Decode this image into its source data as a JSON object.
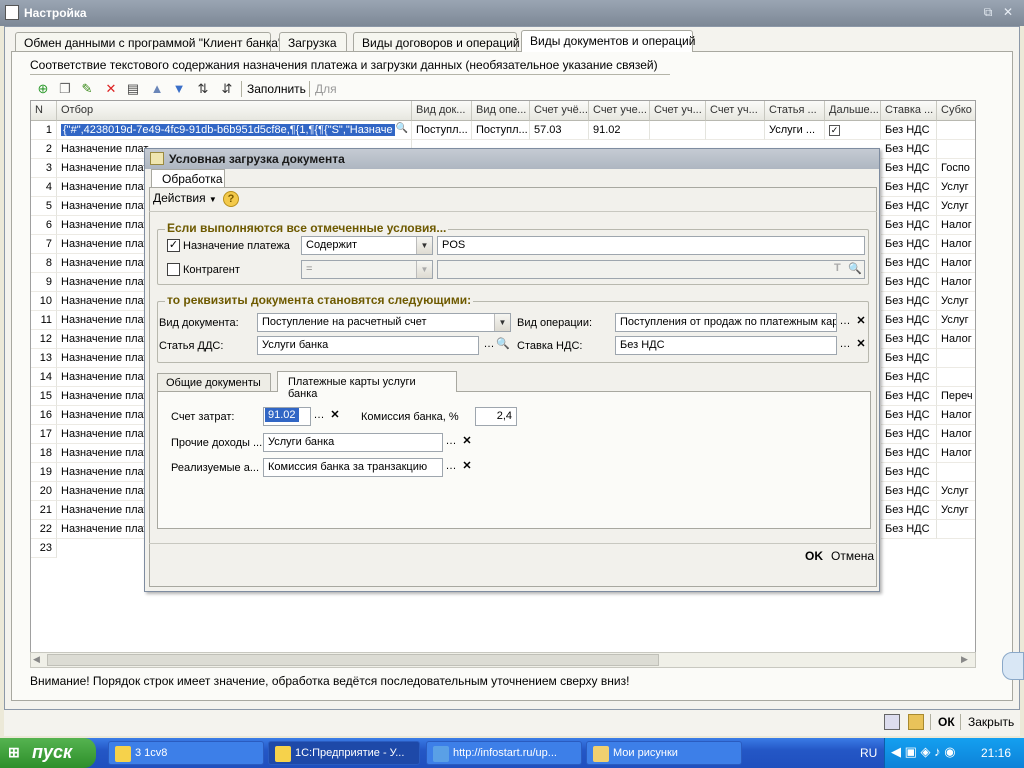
{
  "window": {
    "title": "Настройка"
  },
  "tabs": [
    {
      "label": "Обмен данными с программой \"Клиент банка\""
    },
    {
      "label": "Загрузка"
    },
    {
      "label": "Виды договоров и операций"
    },
    {
      "label": "Виды документов и операций"
    }
  ],
  "section": {
    "title": "Соответствие текстового содержания назначения платежа и загрузки данных (необязательное указание связей)"
  },
  "toolbar": {
    "fill_label": "Заполнить",
    "for_all_label": "Для всех"
  },
  "grid": {
    "headers": [
      "N",
      "Отбор",
      "Вид док...",
      "Вид опе...",
      "Счет учё...",
      "Счет уче...",
      "Счет уч...",
      "Счет уч...",
      "Статья ...",
      "Дальше...",
      "Ставка ...",
      "Субко"
    ],
    "first_row": {
      "num": "1",
      "filter": "{\"#\",4238019d-7e49-4fc9-91db-b6b951d5cf8e,¶{1,¶{¶{\"S\",\"Назначе",
      "doc_type": "Поступл...",
      "op_type": "Поступл...",
      "acc1": "57.03",
      "acc2": "91.02",
      "article": "Услуги ...",
      "vat": "Без НДС"
    },
    "filter_text": "Назначение плат",
    "vat_default": "Без НДС",
    "sub_col": [
      "",
      "",
      "Госпо",
      "Услуг",
      "Услуг",
      "Налог",
      "Налог",
      "Налог",
      "Налог",
      "Услуг",
      "Услуг",
      "Налог",
      "",
      "",
      "Переч",
      "Налог",
      "Налог",
      "Налог",
      "",
      "Услуг",
      "Услуг",
      "",
      ""
    ],
    "row_count": 23
  },
  "warning": "Внимание! Порядок строк имеет значение, обработка ведётся последовательным уточнением сверху вниз!",
  "bottom": {
    "ok_label": "ОК",
    "close_label": "Закрыть"
  },
  "dialog": {
    "title": "Условная загрузка документа",
    "tab": "Обработка",
    "actions_label": "Действия",
    "help_label": "?",
    "cond_title": "Если выполняются все отмеченные условия...",
    "cond1_label": "Назначение платежа",
    "cond1_op": "Содержит",
    "cond1_value": "POS",
    "cond2_label": "Контрагент",
    "cond2_op": "=",
    "res_title": "то реквизиты документа становятся следующими:",
    "doc_type_label": "Вид документа:",
    "doc_type_value": "Поступление на расчетный счет",
    "op_label": "Вид операции:",
    "op_value": "Поступления от продаж по платежным кар",
    "dds_label": "Статья ДДС:",
    "dds_value": "Услуги банка",
    "vat_label": "Ставка НДС:",
    "vat_value": "Без НДС",
    "subtab1": "Общие документы",
    "subtab2": "Платежные карты услуги банка",
    "cost_acc_label": "Счет затрат:",
    "cost_acc_value": "91.02",
    "commission_label": "Комиссия банка, %",
    "commission_value": "2,4",
    "other_income_label": "Прочие доходы ...",
    "other_income_value": "Услуги банка",
    "realized_label": "Реализуемые а...",
    "realized_value": "Комиссия банка за транзакцию",
    "ok_label": "OK",
    "cancel_label": "Отмена"
  },
  "taskbar": {
    "start_label": "пуск",
    "items": [
      {
        "label": "3 1cv8"
      },
      {
        "label": "1С:Предприятие - У..."
      },
      {
        "label": "http://infostart.ru/up..."
      },
      {
        "label": "Мои рисунки"
      }
    ],
    "lang": "RU",
    "clock": "21:16"
  }
}
